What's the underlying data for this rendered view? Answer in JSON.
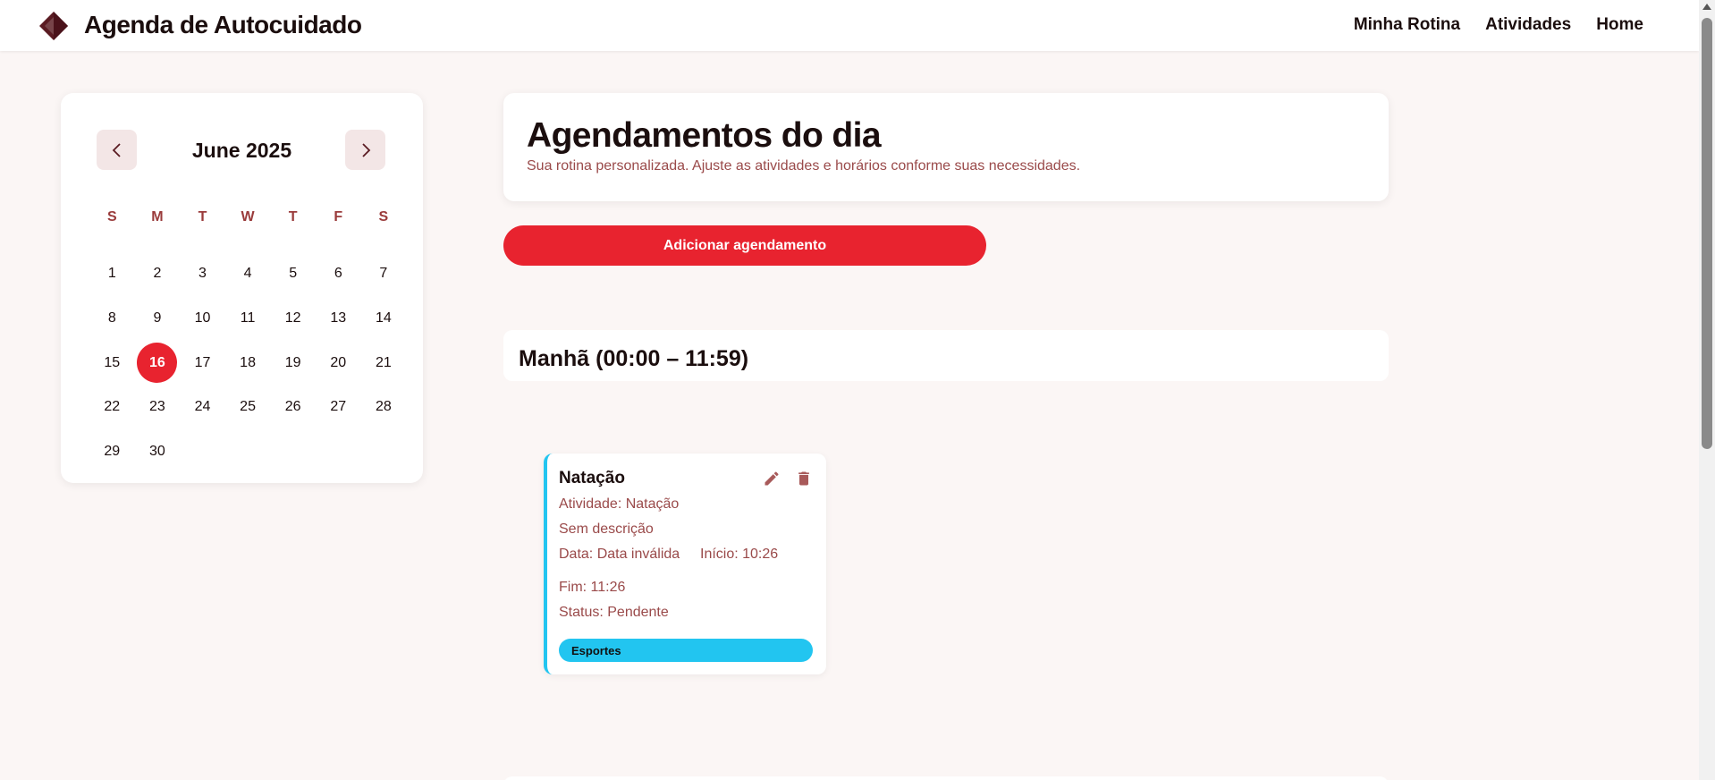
{
  "header": {
    "title": "Agenda de Autocuidado",
    "nav": [
      "Minha Rotina",
      "Atividades",
      "Home"
    ]
  },
  "calendar": {
    "month_label": "June 2025",
    "weekdays": [
      "S",
      "M",
      "T",
      "W",
      "T",
      "F",
      "S"
    ],
    "days": [
      "1",
      "2",
      "3",
      "4",
      "5",
      "6",
      "7",
      "8",
      "9",
      "10",
      "11",
      "12",
      "13",
      "14",
      "15",
      "16",
      "17",
      "18",
      "19",
      "20",
      "21",
      "22",
      "23",
      "24",
      "25",
      "26",
      "27",
      "28",
      "29",
      "30"
    ],
    "selected_day": "16"
  },
  "main": {
    "title": "Agendamentos do dia",
    "subtitle": "Sua rotina personalizada. Ajuste as atividades e horários conforme suas necessidades.",
    "add_button": "Adicionar agendamento",
    "section_title": "Manhã (00:00 – 11:59)"
  },
  "card": {
    "title": "Natação",
    "activity": "Atividade: Natação",
    "description": "Sem descrição",
    "date": "Data: Data inválida",
    "start": "Início: 10:26",
    "end": "Fim: 11:26",
    "status": "Status: Pendente",
    "tag": "Esportes",
    "tag_color": "#22c5f0"
  },
  "colors": {
    "accent": "#e8232f",
    "brand_dark": "#5a1b22",
    "muted_text": "#9a4a4a"
  },
  "icons": {
    "logo": "diamond-logo-icon",
    "prev": "chevron-left-icon",
    "next": "chevron-right-icon",
    "edit": "pencil-icon",
    "delete": "trash-icon"
  }
}
